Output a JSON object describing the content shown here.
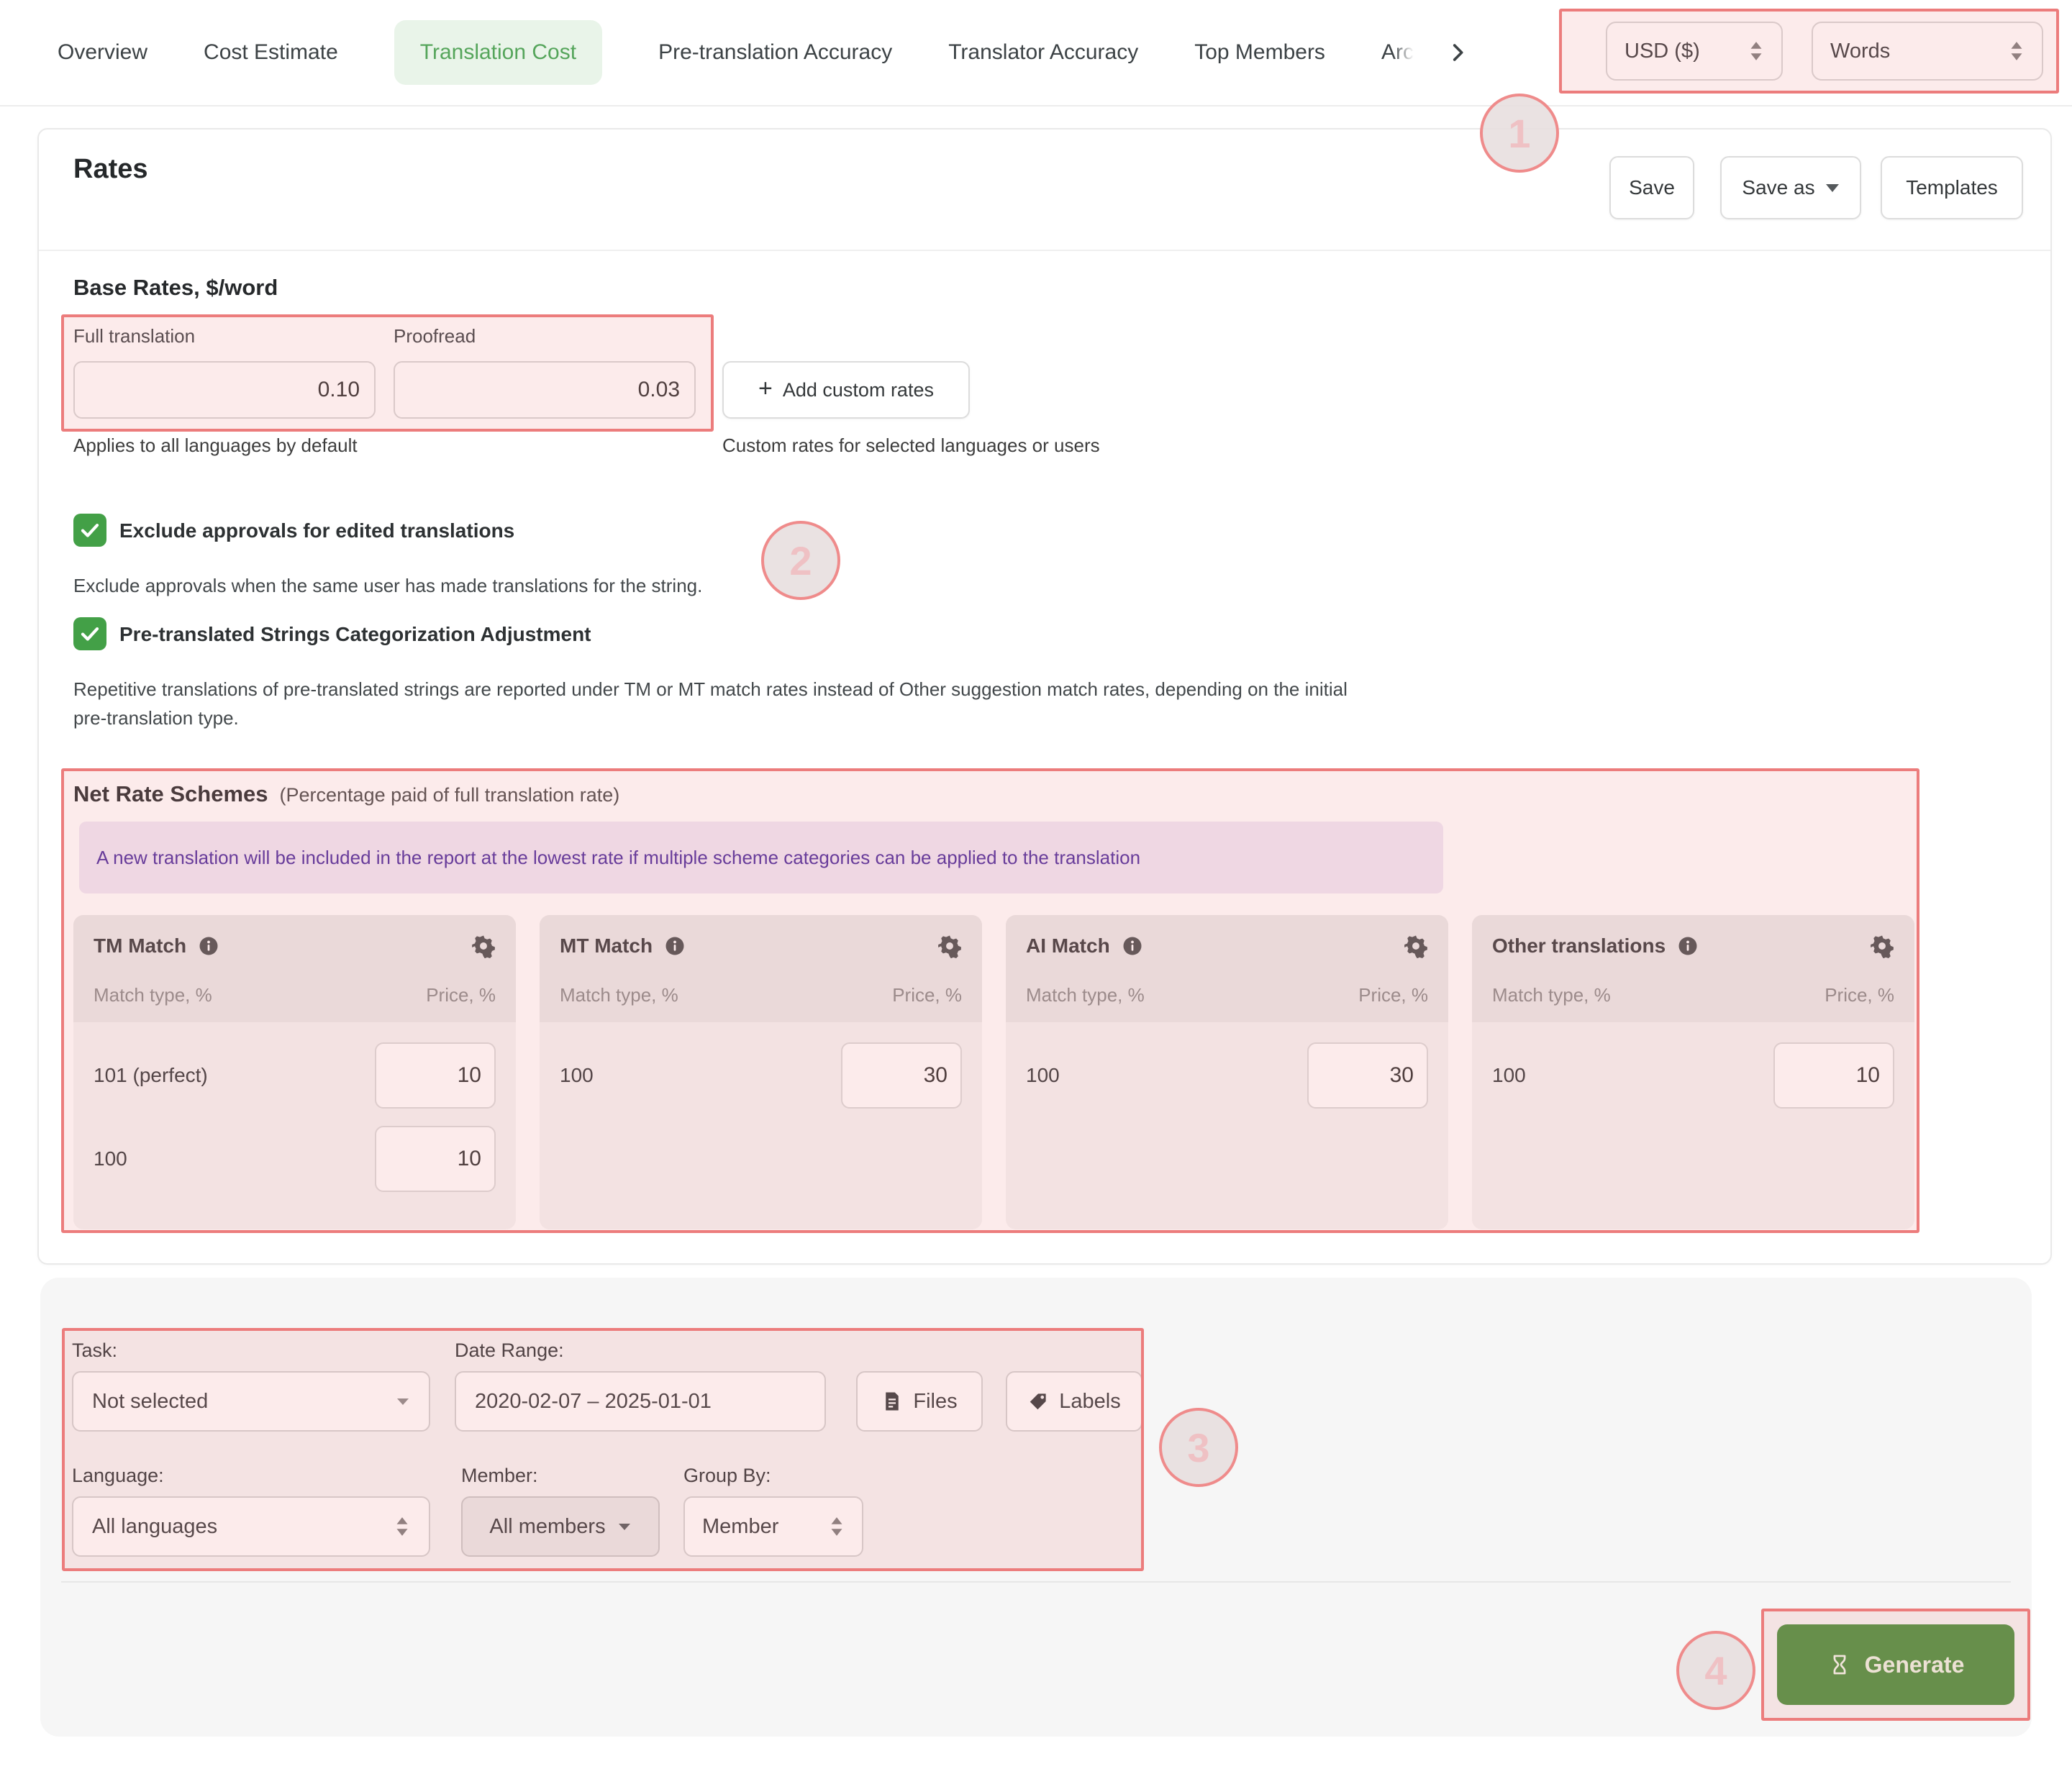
{
  "tabbar": {
    "tabs": [
      {
        "label": "Overview",
        "active": false
      },
      {
        "label": "Cost Estimate",
        "active": false
      },
      {
        "label": "Translation Cost",
        "active": true
      },
      {
        "label": "Pre-translation Accuracy",
        "active": false
      },
      {
        "label": "Translator Accuracy",
        "active": false
      },
      {
        "label": "Top Members",
        "active": false
      }
    ],
    "overflow_label": "Arc",
    "currency_value": "USD ($)",
    "units_value": "Words"
  },
  "rates": {
    "title": "Rates",
    "save_label": "Save",
    "save_as_label": "Save as",
    "templates_label": "Templates"
  },
  "base_rates": {
    "heading": "Base Rates, $/word",
    "full_label": "Full translation",
    "full_value": "0.10",
    "proofread_label": "Proofread",
    "proofread_value": "0.03",
    "add_custom_label": "Add custom rates",
    "plus_glyph": "+",
    "left_caption": "Applies to all languages by default",
    "right_caption": "Custom rates for selected languages or users"
  },
  "options": [
    {
      "label": "Exclude approvals for edited translations",
      "desc": "Exclude approvals when the same user has made translations for the string.",
      "checked": true
    },
    {
      "label": "Pre-translated Strings Categorization Adjustment",
      "desc": "Repetitive translations of pre-translated strings are reported under TM or MT match rates instead of Other suggestion match rates, depending on the initial pre-translation type.",
      "checked": true
    }
  ],
  "nrs": {
    "title": "Net Rate Schemes",
    "subtitle": "(Percentage paid of full translation rate)",
    "note": "A new translation will be included in the report at the lowest rate if multiple scheme categories can be applied to the translation",
    "col_match": "Match type, %",
    "col_price": "Price, %",
    "cards": [
      {
        "title": "TM Match",
        "rows": [
          {
            "type": "101 (perfect)",
            "price": "10"
          },
          {
            "type": "100",
            "price": "10"
          }
        ]
      },
      {
        "title": "MT Match",
        "rows": [
          {
            "type": "100",
            "price": "30"
          }
        ]
      },
      {
        "title": "AI Match",
        "rows": [
          {
            "type": "100",
            "price": "30"
          }
        ]
      },
      {
        "title": "Other translations",
        "rows": [
          {
            "type": "100",
            "price": "10"
          }
        ]
      }
    ]
  },
  "filters": {
    "task_label": "Task:",
    "task_value": "Not selected",
    "date_label": "Date Range:",
    "date_value": "2020-02-07 – 2025-01-01",
    "files_label": "Files",
    "labels_label": "Labels",
    "language_label": "Language:",
    "language_value": "All languages",
    "member_label": "Member:",
    "member_value": "All members",
    "group_label": "Group By:",
    "group_value": "Member"
  },
  "generate": {
    "label": "Generate"
  },
  "badges": [
    "1",
    "2",
    "3",
    "4"
  ],
  "colors": {
    "accent_green": "#55a55b",
    "generate_green": "#4a8f3c",
    "checkbox_green": "#43a047",
    "annotation_red": "#ec7c7c",
    "note_purple_text": "#4b2a9d",
    "note_purple_bg": "#efe7f6"
  }
}
